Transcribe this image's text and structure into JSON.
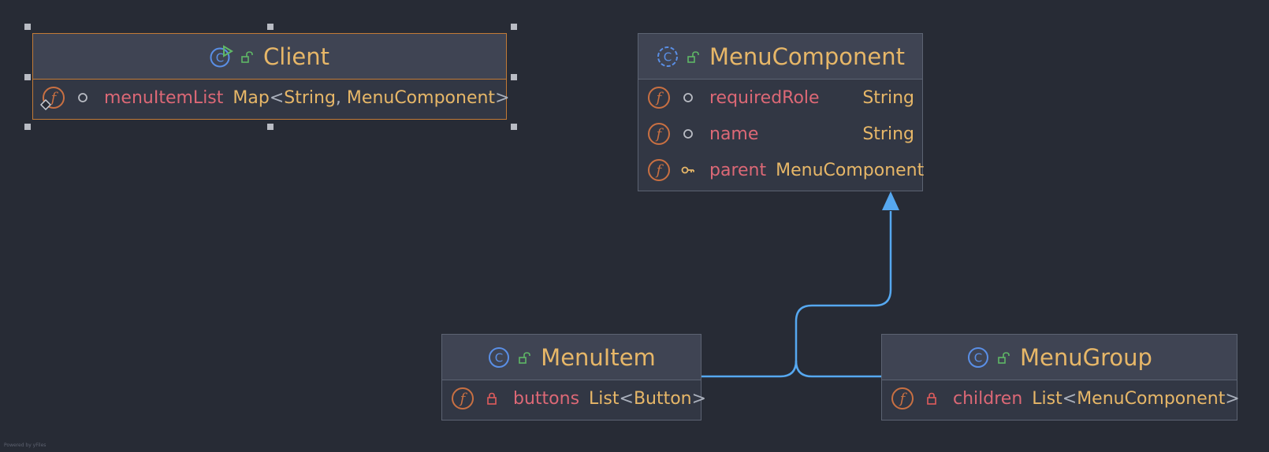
{
  "nodes": {
    "client": {
      "title": "Client",
      "fields": [
        {
          "name": "menuItemList",
          "type_prefix": "Map",
          "lt": "<",
          "type_a": "String",
          "comma": ",",
          "type_b": "MenuComponent",
          "gt": ">"
        }
      ]
    },
    "menu_component": {
      "title": "MenuComponent",
      "fields": [
        {
          "name": "requiredRole",
          "type": "String"
        },
        {
          "name": "name",
          "type": "String"
        },
        {
          "name": "parent",
          "type": "MenuComponent"
        }
      ]
    },
    "menu_item": {
      "title": "MenuItem",
      "fields": [
        {
          "name": "buttons",
          "type_prefix": "List",
          "lt": "<",
          "type_inner": "Button",
          "gt": ">"
        }
      ]
    },
    "menu_group": {
      "title": "MenuGroup",
      "fields": [
        {
          "name": "children",
          "type_prefix": "List",
          "lt": "<",
          "type_inner": "MenuComponent",
          "gt": ">"
        }
      ]
    }
  },
  "icons": {
    "class": "class-icon",
    "abstract_class": "abstract-class-icon",
    "runnable_class": "runnable-class-icon",
    "public": "unlocked-icon",
    "private": "lock-icon",
    "package_private": "circle-icon",
    "protected": "key-icon",
    "field": "field-icon"
  },
  "colors": {
    "background": "#272b35",
    "class_name": "#e7b768",
    "field_name": "#dc6876",
    "field_icon": "#c97042",
    "class_icon": "#5a8fe6",
    "public_icon": "#5fb866",
    "private_icon": "#e05c5c",
    "inheritance_arrow": "#56a8f0",
    "selection": "#c27a36"
  },
  "watermark": "Powered by yFiles"
}
